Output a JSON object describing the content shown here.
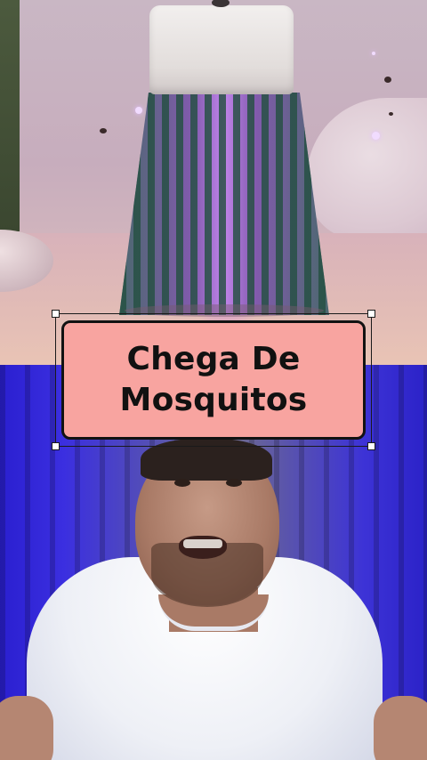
{
  "top_clip": {
    "subject": "purple UV mosquito lamp"
  },
  "caption": {
    "line1": "Chega De",
    "line2": "Mosquitos",
    "background_color": "#f8a4a0",
    "border_color": "#121212"
  },
  "bottom_clip": {
    "subject": "man speaking to camera"
  }
}
